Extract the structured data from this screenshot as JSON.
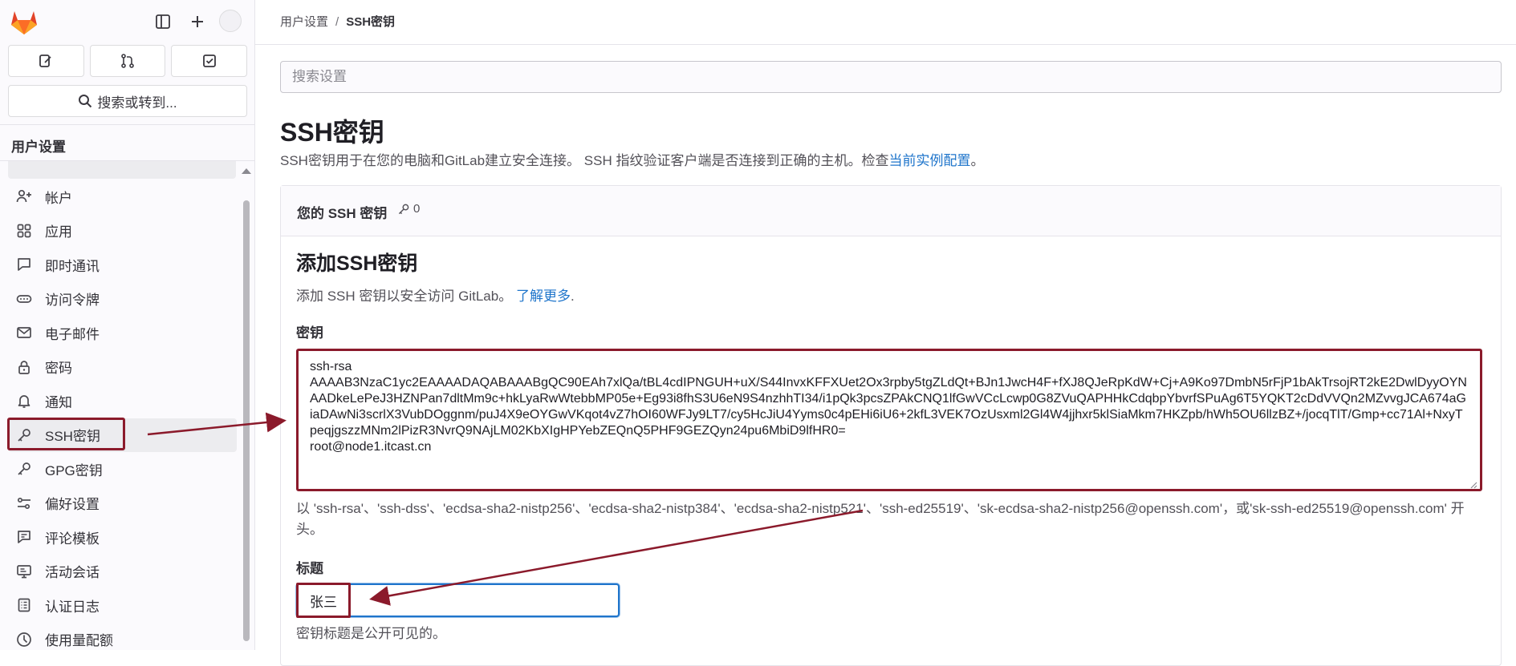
{
  "sidebar": {
    "search_label": "搜索或转到...",
    "section_title": "用户设置",
    "items": [
      {
        "label": "帐户",
        "icon": "user-plus-icon"
      },
      {
        "label": "应用",
        "icon": "applications-icon"
      },
      {
        "label": "即时通讯",
        "icon": "chat-icon"
      },
      {
        "label": "访问令牌",
        "icon": "token-icon"
      },
      {
        "label": "电子邮件",
        "icon": "mail-icon"
      },
      {
        "label": "密码",
        "icon": "lock-icon"
      },
      {
        "label": "通知",
        "icon": "bell-icon"
      },
      {
        "label": "SSH密钥",
        "icon": "key-icon",
        "active": true
      },
      {
        "label": "GPG密钥",
        "icon": "key-icon"
      },
      {
        "label": "偏好设置",
        "icon": "preferences-icon"
      },
      {
        "label": "评论模板",
        "icon": "comment-template-icon"
      },
      {
        "label": "活动会话",
        "icon": "monitor-icon"
      },
      {
        "label": "认证日志",
        "icon": "log-icon"
      },
      {
        "label": "使用量配额",
        "icon": "quota-icon"
      }
    ]
  },
  "breadcrumb": {
    "parent": "用户设置",
    "separator": "/",
    "current": "SSH密钥"
  },
  "settings_search": {
    "placeholder": "搜索设置"
  },
  "page": {
    "title": "SSH密钥",
    "description": "SSH密钥用于在您的电脑和GitLab建立安全连接。 SSH 指纹验证客户端是否连接到正确的主机。检查",
    "description_link": "当前实例配置",
    "description_end": "。"
  },
  "card": {
    "title": "您的 SSH 密钥",
    "count": "0"
  },
  "form": {
    "title": "添加SSH密钥",
    "description": "添加 SSH 密钥以安全访问 GitLab。",
    "learn_more": "了解更多",
    "learn_more_end": ".",
    "key_label": "密钥",
    "key_value": "ssh-rsa\nAAAAB3NzaC1yc2EAAAADAQABAAABgQC90EAh7xlQa/tBL4cdIPNGUH+uX/S44InvxKFFXUet2Ox3rpby5tgZLdQt+BJn1JwcH4F+fXJ8QJeRpKdW+Cj+A9Ko97DmbN5rFjP1bAkTrsojRT2kE2DwlDyyOYNAADkeLePeJ3HZNPan7dltMm9c+hkLyaRwWtebbMP05e+Eg93i8fhS3U6eN9S4nzhhTI34/i1pQk3pcsZPAkCNQ1lfGwVCcLcwp0G8ZVuQAPHHkCdqbpYbvrfSPuAg6T5YQKT2cDdVVQn2MZvvgJCA674aGiaDAwNi3scrlX3VubDOggnm/puJ4X9eOYGwVKqot4vZ7hOI60WFJy9LT7/cy5HcJiU4Yyms0c4pEHi6iU6+2kfL3VEK7OzUsxml2Gl4W4jjhxr5klSiaMkm7HKZpb/hWh5OU6llzBZ+/jocqTlT/Gmp+cc71Al+NxyTpeqjgszzMNm2lPizR3NvrQ9NAjLM02KbXIgHPYebZEQnQ5PHF9GEZQyn24pu6MbiD9lfHR0=\nroot@node1.itcast.cn",
    "key_hint": "以 'ssh-rsa'、'ssh-dss'、'ecdsa-sha2-nistp256'、'ecdsa-sha2-nistp384'、'ecdsa-sha2-nistp521'、'ssh-ed25519'、'sk-ecdsa-sha2-nistp256@openssh.com'，或'sk-ssh-ed25519@openssh.com' 开头。",
    "title_label": "标题",
    "title_value": "张三",
    "title_help": "密钥标题是公开可见的。"
  },
  "colors": {
    "accent": "#1f75cb",
    "annotation": "#8b1a2b",
    "brand_orange": "#fc6d26"
  }
}
